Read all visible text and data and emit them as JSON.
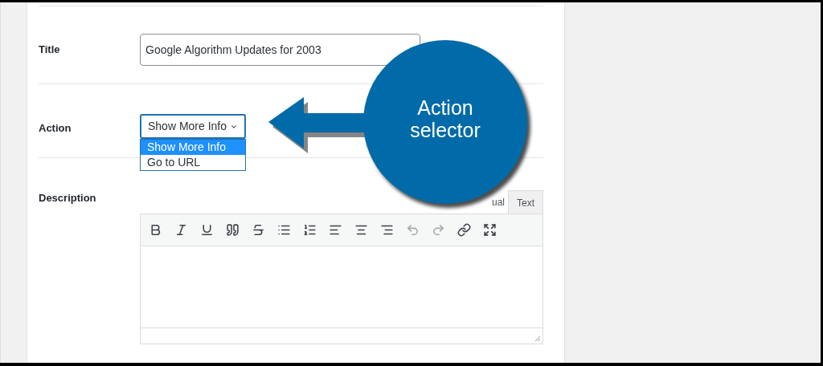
{
  "form": {
    "title_field": {
      "label": "Title",
      "value": "Google Algorithm Updates for 2003"
    },
    "action_field": {
      "label": "Action",
      "value": "Show More Info",
      "expanded": true,
      "options": [
        {
          "label": "Show More Info",
          "selected": true
        },
        {
          "label": "Go to URL",
          "selected": false
        }
      ]
    },
    "description_field": {
      "label": "Description",
      "tabs": [
        {
          "label": "ual",
          "selected": false
        },
        {
          "label": "Text",
          "selected": true
        }
      ],
      "toolbar": [
        {
          "kind": "bold",
          "disabled": false
        },
        {
          "kind": "italic",
          "disabled": false
        },
        {
          "kind": "underline",
          "disabled": false
        },
        {
          "kind": "quote",
          "disabled": false
        },
        {
          "kind": "strike",
          "disabled": false
        },
        {
          "kind": "bullets",
          "disabled": false
        },
        {
          "kind": "numbers",
          "disabled": false
        },
        {
          "kind": "align-left",
          "disabled": false
        },
        {
          "kind": "align-center",
          "disabled": false
        },
        {
          "kind": "align-right",
          "disabled": false
        },
        {
          "kind": "undo",
          "disabled": true
        },
        {
          "kind": "redo",
          "disabled": true
        },
        {
          "kind": "link",
          "disabled": false
        },
        {
          "kind": "fullscreen",
          "disabled": false
        }
      ]
    }
  },
  "callout": {
    "text": "Action selector"
  }
}
